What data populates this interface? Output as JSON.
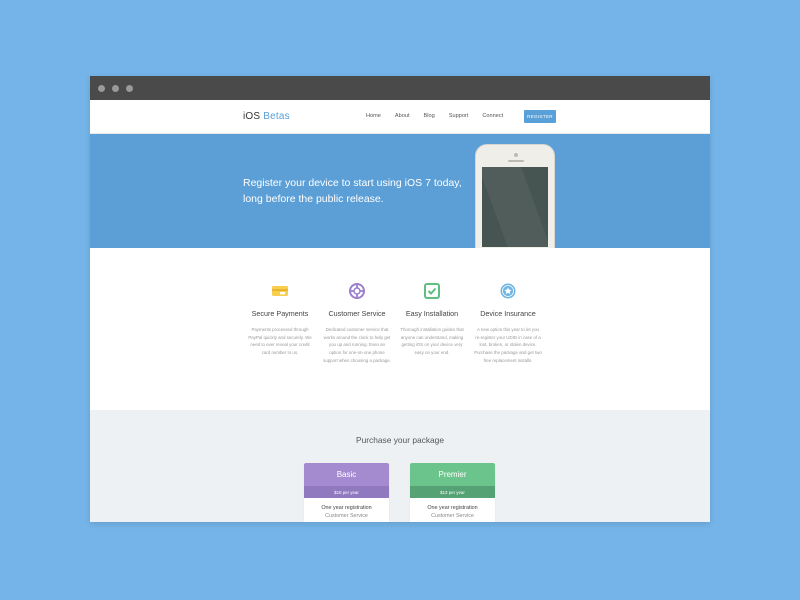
{
  "brand": {
    "name": "iOS",
    "accent": "Betas"
  },
  "nav": {
    "links": [
      "Home",
      "About",
      "Blog",
      "Support",
      "Connect"
    ],
    "register": "REGISTER"
  },
  "hero": {
    "line1": "Register your device to start using iOS 7 today,",
    "line2": "long before the public release."
  },
  "features": [
    {
      "icon": "credit-card-icon",
      "title": "Secure Payments",
      "text": "Payments processed through PayPal quickly and securely. We need to ever reveal your credit card number to us."
    },
    {
      "icon": "lifebuoy-icon",
      "title": "Customer Service",
      "text": "Dedicated customer service that works around the clock to help get you up and running. Even an option for one-on-one phone support when choosing a package."
    },
    {
      "icon": "checkbox-icon",
      "title": "Easy Installation",
      "text": "Thorough installation guides that anyone can understand, making getting iOS on your device very easy on your end."
    },
    {
      "icon": "star-badge-icon",
      "title": "Device Insurance",
      "text": "A new option this year to let you re-register your UDID in case of a lost, broken, or stolen device. Purchase the package and get two free replacement installs."
    }
  ],
  "pricing": {
    "title": "Purchase your package",
    "plans": [
      {
        "name": "Basic",
        "price": "$10 per year",
        "line1": "One year registration",
        "line2": "Customer Service"
      },
      {
        "name": "Premier",
        "price": "$13 per year",
        "line1": "One year registration",
        "line2": "Customer Service"
      }
    ]
  },
  "colors": {
    "accent": "#5aa0d8",
    "hero": "#5b9fd6",
    "basic_head": "#a48bd0",
    "basic_price": "#9179c0",
    "premier_head": "#6bc48b",
    "premier_price": "#55a374"
  }
}
